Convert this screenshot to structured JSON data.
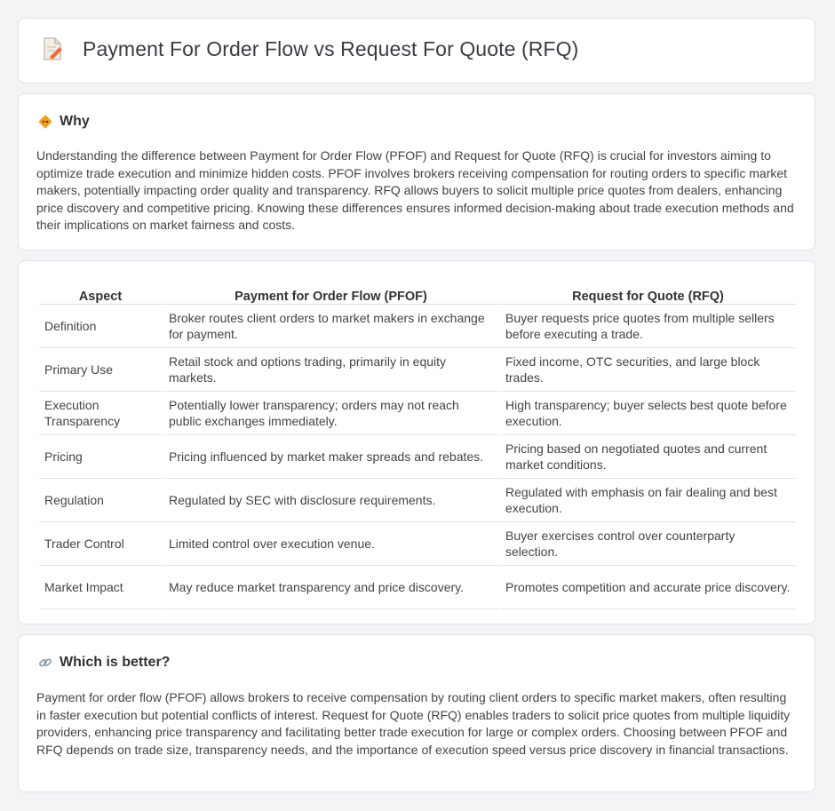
{
  "page": {
    "title": "Payment For Order Flow vs Request For Quote (RFQ)"
  },
  "why": {
    "heading": "Why",
    "text": "Understanding the difference between Payment for Order Flow (PFOF) and Request for Quote (RFQ) is crucial for investors aiming to optimize trade execution and minimize hidden costs. PFOF involves brokers receiving compensation for routing orders to specific market makers, potentially impacting order quality and transparency. RFQ allows buyers to solicit multiple price quotes from dealers, enhancing price discovery and competitive pricing. Knowing these differences ensures informed decision-making about trade execution methods and their implications on market fairness and costs."
  },
  "comparison": {
    "headers": [
      "Aspect",
      "Payment for Order Flow (PFOF)",
      "Request for Quote (RFQ)"
    ],
    "rows": [
      {
        "aspect": "Definition",
        "pfof": "Broker routes client orders to market makers in exchange for payment.",
        "rfq": "Buyer requests price quotes from multiple sellers before executing a trade."
      },
      {
        "aspect": "Primary Use",
        "pfof": "Retail stock and options trading, primarily in equity markets.",
        "rfq": "Fixed income, OTC securities, and large block trades."
      },
      {
        "aspect": "Execution Transparency",
        "pfof": "Potentially lower transparency; orders may not reach public exchanges immediately.",
        "rfq": "High transparency; buyer selects best quote before execution."
      },
      {
        "aspect": "Pricing",
        "pfof": "Pricing influenced by market maker spreads and rebates.",
        "rfq": "Pricing based on negotiated quotes and current market conditions."
      },
      {
        "aspect": "Regulation",
        "pfof": "Regulated by SEC with disclosure requirements.",
        "rfq": "Regulated with emphasis on fair dealing and best execution."
      },
      {
        "aspect": "Trader Control",
        "pfof": "Limited control over execution venue.",
        "rfq": "Buyer exercises control over counterparty selection."
      },
      {
        "aspect": "Market Impact",
        "pfof": "May reduce market transparency and price discovery.",
        "rfq": "Promotes competition and accurate price discovery."
      }
    ]
  },
  "better": {
    "heading": "Which is better?",
    "text": "Payment for order flow (PFOF) allows brokers to receive compensation by routing client orders to specific market makers, often resulting in faster execution but potential conflicts of interest. Request for Quote (RFQ) enables traders to solicit price quotes from multiple liquidity providers, enhancing price transparency and facilitating better trade execution for large or complex orders. Choosing between PFOF and RFQ depends on trade size, transparency needs, and the importance of execution speed versus price discovery in financial transactions."
  },
  "icons": {
    "title": "document-pencil-icon",
    "why": "diamond-sign-icon",
    "better": "link-icon"
  },
  "colors": {
    "background": "#f4f4f6",
    "card": "#ffffff",
    "icon_orange": "#f0a020",
    "icon_red": "#e05a3a"
  }
}
